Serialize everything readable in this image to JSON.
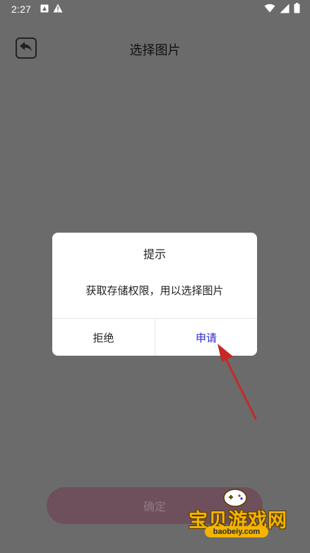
{
  "status_bar": {
    "time": "2:27",
    "icons": [
      "a-icon",
      "warning-icon",
      "wifi-icon",
      "signal-icon",
      "battery-icon"
    ]
  },
  "header": {
    "title": "选择图片",
    "back_icon": "reply-arrow-icon"
  },
  "dialog": {
    "title": "提示",
    "message": "获取存储权限，用以选择图片",
    "reject_label": "拒绝",
    "apply_label": "申请",
    "apply_color": "#2a2ad0"
  },
  "footer": {
    "confirm_label": "确定",
    "confirm_color": "#6e4f5c"
  },
  "watermark": {
    "text": "宝贝游戏网",
    "url": "baobeiy.com"
  },
  "colors": {
    "overlay": "#6b6b6b",
    "arrow": "#c62828"
  }
}
